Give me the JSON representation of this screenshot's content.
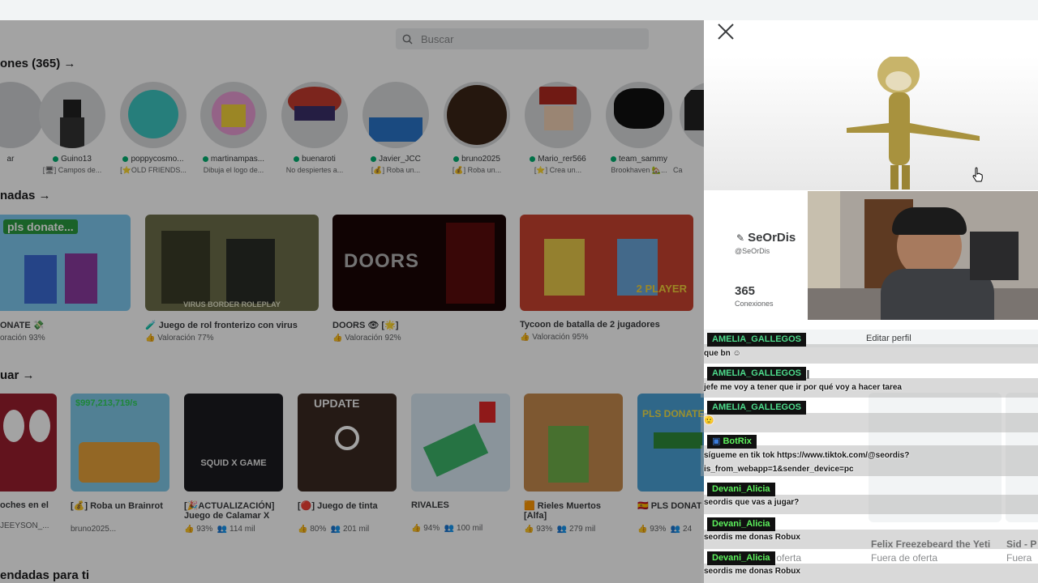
{
  "search": {
    "placeholder": "Buscar"
  },
  "sections": {
    "friends": "ones (365) →",
    "recommended": "nadas →",
    "continue": "uar →",
    "for_you": "endadas para ti"
  },
  "friends": [
    {
      "name": "ar",
      "sub": ""
    },
    {
      "name": "Guino13",
      "sub": "[🖥] Campos de..."
    },
    {
      "name": "poppycosmo...",
      "sub": "[⭐OLD FRIENDS..."
    },
    {
      "name": "martinampas...",
      "sub": "Dibuja el logo de..."
    },
    {
      "name": "buenaroti",
      "sub": "No despiertes a..."
    },
    {
      "name": "Javier_JCC",
      "sub": "[💰] Roba un..."
    },
    {
      "name": "bruno2025",
      "sub": "[💰] Roba un..."
    },
    {
      "name": "Mario_rer566",
      "sub": "[⭐] Crea un..."
    },
    {
      "name": "team_sammy",
      "sub": "Brookhaven 🏡..."
    },
    {
      "name": "",
      "sub": "Ca"
    }
  ],
  "games_row1": [
    {
      "title": "ONATE 💸",
      "stat": "oración 93%",
      "thumb_text": "pls donate..."
    },
    {
      "title": "🧪 Juego de rol fronterizo con virus",
      "stat": "Valoración 77%",
      "thumb_text": "VIRUS BORDER ROLEPLAY"
    },
    {
      "title": "DOORS 👁 [🌟]",
      "stat": "Valoración 92%",
      "thumb_text": "DOORS"
    },
    {
      "title": "Tycoon de batalla de 2 jugadores",
      "stat": "Valoración 95%",
      "thumb_text": "2 PLAYER"
    }
  ],
  "games_row2": [
    {
      "title": "oches en el",
      "stat": "JEEYSON_...",
      "rating": "",
      "players": "",
      "thumb_text": ""
    },
    {
      "title": "[💰] Roba un Brainrot",
      "stat": "bruno2025...",
      "rating": "",
      "players": "",
      "thumb_text": "$997,213,719/s"
    },
    {
      "title": "[🎉ACTUALIZACIÓN] Juego de Calamar X",
      "stat": "",
      "rating": "93%",
      "players": "114 mil",
      "thumb_text": "SQUID X GAME"
    },
    {
      "title": "[🔴] Juego de tinta",
      "stat": "",
      "rating": "80%",
      "players": "201 mil",
      "thumb_text": "UPDATE"
    },
    {
      "title": "RIVALES",
      "stat": "",
      "rating": "94%",
      "players": "100 mil",
      "thumb_text": ""
    },
    {
      "title": "🟧 Rieles Muertos [Alfa]",
      "stat": "",
      "rating": "93%",
      "players": "279 mil",
      "thumb_text": ""
    },
    {
      "title": "🇪🇸 PLS DONAT",
      "stat": "",
      "rating": "93%",
      "players": "24",
      "thumb_text": "PLS DONATE"
    }
  ],
  "profile": {
    "display_name": "SeOrDis",
    "handle": "@SeOrDis",
    "connections_count": "365",
    "connections_label": "Conexiones",
    "edit_button": "Editar perfil",
    "shop_items": [
      {
        "name": "Felix Freezebeard the Yeti",
        "status": "Fuera de oferta"
      },
      {
        "name": "Sid - P",
        "status": "Fuera"
      },
      {
        "name": "",
        "status": "Fuera de oferta"
      }
    ],
    "partial_label": "al"
  },
  "chat": [
    {
      "user": "AMELIA_GALLEGOS",
      "text": "que bn ☺",
      "color": "#4ddb8c"
    },
    {
      "user": "AMELIA_GALLEGOS",
      "text": "jefe me voy a tener que ir por qué voy a hacer tarea",
      "color": "#4ddb8c"
    },
    {
      "user": "AMELIA_GALLEGOS",
      "text": "🫡",
      "color": "#4ddb8c"
    },
    {
      "user": "BotRix",
      "text": "sígueme en tik tok https://www.tiktok.com/@seordis?",
      "text2": "is_from_webapp=1&sender_device=pc",
      "color": "#5df25d"
    },
    {
      "user": "Devani_Alicia",
      "text": "seordis que vas a jugar?",
      "color": "#5df25d"
    },
    {
      "user": "Devani_Alicia",
      "text": "seordis me donas Robux",
      "color": "#5df25d"
    },
    {
      "user": "Devani_Alicia",
      "text": "seordis me donas Robux",
      "color": "#5df25d"
    }
  ]
}
